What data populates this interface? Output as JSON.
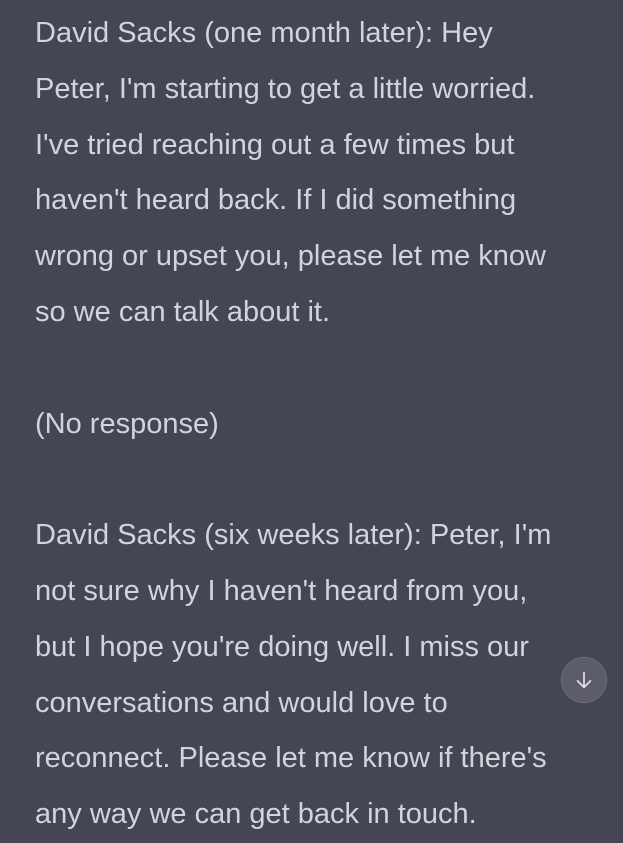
{
  "conversation": {
    "paragraphs": [
      "David Sacks (one month later): Hey\nPeter, I'm starting to get a little worried.\nI've tried reaching out a few times but\nhaven't heard back. If I did something\nwrong or upset you, please let me know\nso we can talk about it.",
      "(No response)",
      "David Sacks (six weeks later): Peter, I'm\nnot sure why I haven't heard from you,\nbut I hope you're doing well. I miss our\nconversations and would love to\nreconnect. Please let me know if there's\nany way we can get back in touch."
    ]
  },
  "scroll_button": {
    "icon": "arrow-down-icon"
  },
  "colors": {
    "background": "#444654",
    "text": "#d1d5db",
    "button_bg": "#5b5c67"
  }
}
